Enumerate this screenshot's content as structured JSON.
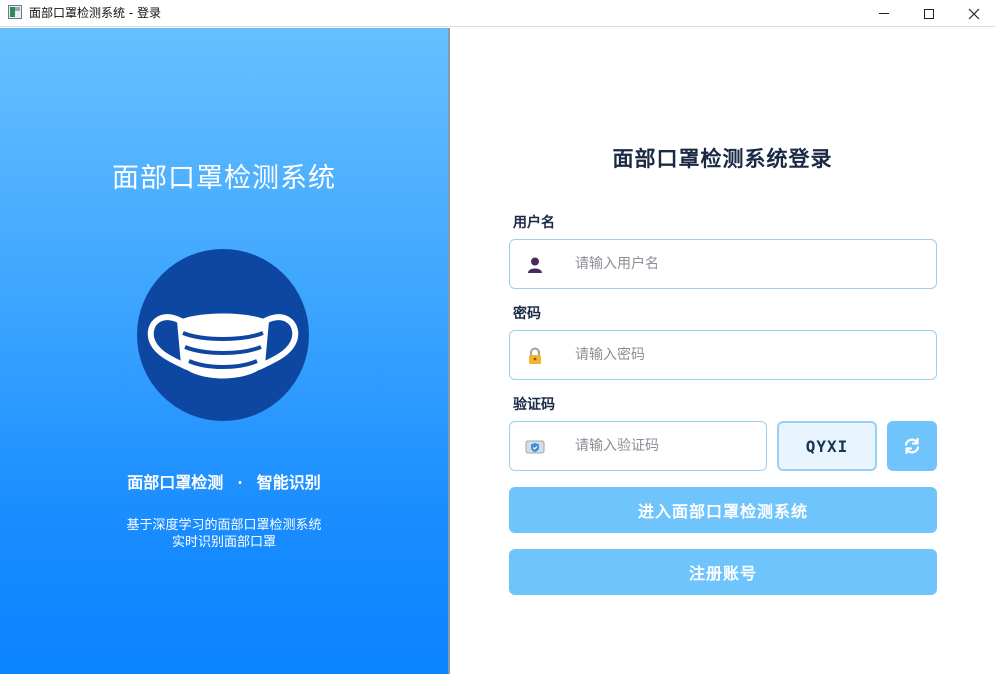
{
  "window": {
    "title": "面部口罩检测系统 - 登录",
    "minimize_icon": "minimize-icon",
    "maximize_icon": "maximize-icon",
    "close_icon": "close-icon"
  },
  "left": {
    "title": "面部口罩检测系统",
    "logo_icon": "face-mask-icon",
    "tagline_left": "面部口罩检测",
    "tagline_sep": "·",
    "tagline_right": "智能识别",
    "desc_line1": "基于深度学习的面部口罩检测系统",
    "desc_line2": "实时识别面部口罩"
  },
  "form": {
    "title": "面部口罩检测系统登录",
    "username_label": "用户名",
    "username_placeholder": "请输入用户名",
    "username_value": "",
    "password_label": "密码",
    "password_placeholder": "请输入密码",
    "password_value": "",
    "captcha_label": "验证码",
    "captcha_placeholder": "请输入验证码",
    "captcha_value": "",
    "captcha_code": "QYXI",
    "login_button": "进入面部口罩检测系统",
    "register_button": "注册账号"
  },
  "colors": {
    "accent": "#6ec4fb",
    "gradient_top": "#66c0ff",
    "gradient_bottom": "#0a84ff",
    "logo_circle": "#0d47a1",
    "input_border": "#9ad0f5",
    "captcha_bg": "#e8f5ff"
  }
}
